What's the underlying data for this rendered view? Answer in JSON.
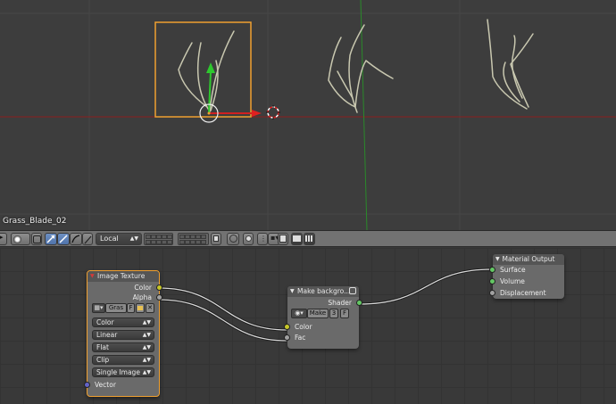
{
  "viewport": {
    "object_name": "Grass_Blade_02",
    "colors": {
      "background": "#3d3d3d",
      "grid": "#4a4a4a",
      "x_axis": "#8c2020",
      "y_axis": "#2a8a2a",
      "selection": "#f0a030",
      "grass": "#c9c8b0"
    }
  },
  "header": {
    "pivot_value": "Local",
    "icons": [
      "view-menu-icon",
      "shading-icon",
      "manipulator-icon",
      "translate-icon",
      "rotate-icon",
      "scale-icon",
      "layers-icon",
      "lock-icon",
      "snap-icon",
      "proportional-icon",
      "render-icon",
      "camera-icon"
    ]
  },
  "nodes": {
    "image_texture": {
      "title": "Image Texture",
      "out_color": "Color",
      "out_alpha": "Alpha",
      "image_name": "Gras",
      "image_flag": "F",
      "color_space": "Color",
      "interpolation": "Linear",
      "projection": "Flat",
      "extension": "Clip",
      "source": "Single Image",
      "in_vector": "Vector"
    },
    "make_background": {
      "title": "Make backgro...",
      "out_shader": "Shader",
      "group_name": "Make",
      "users": "3",
      "fake_user": "F",
      "in_color": "Color",
      "in_fac": "Fac"
    },
    "material_output": {
      "title": "Material Output",
      "in_surface": "Surface",
      "in_volume": "Volume",
      "in_displacement": "Displacement"
    }
  },
  "colors": {
    "socket_color": "#c7c729",
    "socket_float": "#a1a1a1",
    "socket_shader": "#63c763",
    "socket_vector": "#6363c7",
    "active_node": "#f0a030"
  }
}
